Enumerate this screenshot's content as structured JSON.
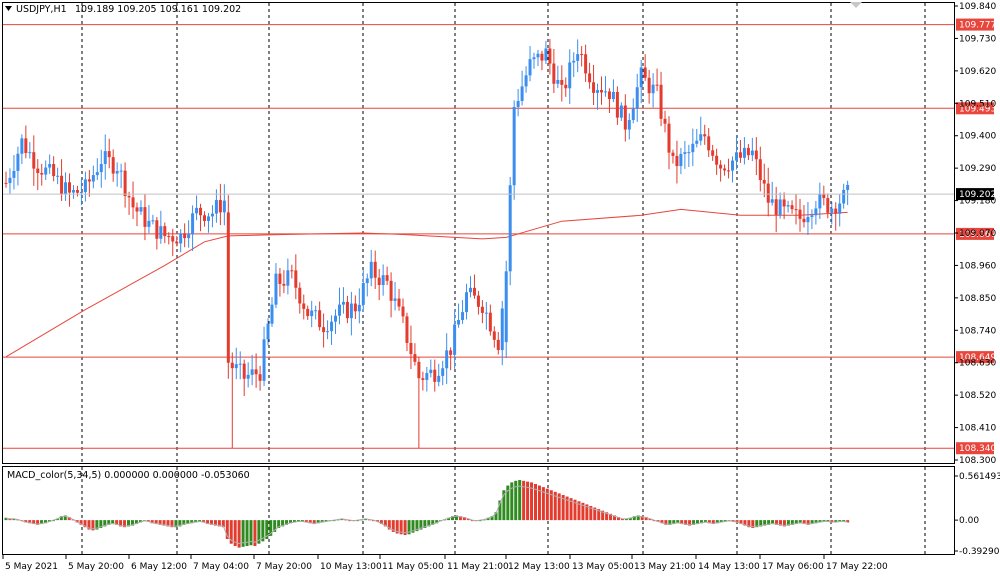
{
  "header": {
    "symbol_timeframe": "USDJPY,H1",
    "ohlc": "109.189 109.205 109.161 109.202"
  },
  "macd_header": "MACD_color(5,34,5) 0.000000 0.000000 -0.053060",
  "colors": {
    "bull": "#3b8ef0",
    "bear": "#e33b2e",
    "level": "#e8453c",
    "ma": "#e8453c",
    "grid": "#000000",
    "hist_up": "#2f8a1f",
    "hist_down": "#e33b2e",
    "signal": "#b0b0b0"
  },
  "icons": {
    "dropdown": "triangle-down-icon",
    "scroll": "chevron-down-icon"
  },
  "chart_data": [
    {
      "type": "candlestick",
      "title": "USDJPY,H1",
      "ylim": [
        108.3,
        109.84
      ],
      "price_ticks": [
        "109.840",
        "109.730",
        "109.620",
        "109.510",
        "109.400",
        "109.290",
        "109.180",
        "109.070",
        "108.960",
        "108.850",
        "108.740",
        "108.630",
        "108.520",
        "108.410",
        "108.300"
      ],
      "time_ticks": [
        "5 May 2021",
        "5 May 20:00",
        "6 May 12:00",
        "7 May 04:00",
        "7 May 20:00",
        "10 May 13:00",
        "11 May 05:00",
        "11 May 21:00",
        "12 May 13:00",
        "13 May 05:00",
        "13 May 21:00",
        "14 May 13:00",
        "17 May 06:00",
        "17 May 22:00"
      ],
      "levels": [
        {
          "label": "109.777",
          "value": 109.777
        },
        {
          "label": "109.493",
          "value": 109.493
        },
        {
          "label": "109.067",
          "value": 109.067
        },
        {
          "label": "108.649",
          "value": 108.649
        },
        {
          "label": "108.340",
          "value": 108.34
        }
      ],
      "current_price": {
        "label": "109.202",
        "value": 109.202
      },
      "anchors": [
        [
          0,
          109.24
        ],
        [
          4,
          109.38
        ],
        [
          8,
          109.3
        ],
        [
          12,
          109.26
        ],
        [
          16,
          109.2
        ],
        [
          20,
          109.22
        ],
        [
          24,
          109.32
        ],
        [
          28,
          109.3
        ],
        [
          32,
          109.16
        ],
        [
          36,
          109.1
        ],
        [
          40,
          109.06
        ],
        [
          44,
          109.06
        ],
        [
          48,
          109.14
        ],
        [
          52,
          109.14
        ],
        [
          55,
          109.18
        ],
        [
          56,
          108.63
        ],
        [
          60,
          108.58
        ],
        [
          64,
          108.6
        ],
        [
          68,
          108.9
        ],
        [
          72,
          108.92
        ],
        [
          76,
          108.8
        ],
        [
          80,
          108.76
        ],
        [
          84,
          108.8
        ],
        [
          88,
          108.82
        ],
        [
          92,
          108.94
        ],
        [
          96,
          108.9
        ],
        [
          100,
          108.76
        ],
        [
          104,
          108.58
        ],
        [
          108,
          108.6
        ],
        [
          112,
          108.68
        ],
        [
          116,
          108.86
        ],
        [
          120,
          108.83
        ],
        [
          124,
          108.7
        ],
        [
          126,
          108.94
        ],
        [
          128,
          109.5
        ],
        [
          132,
          109.64
        ],
        [
          136,
          109.68
        ],
        [
          140,
          109.54
        ],
        [
          144,
          109.7
        ],
        [
          148,
          109.58
        ],
        [
          152,
          109.55
        ],
        [
          156,
          109.44
        ],
        [
          160,
          109.6
        ],
        [
          164,
          109.54
        ],
        [
          168,
          109.3
        ],
        [
          172,
          109.34
        ],
        [
          176,
          109.4
        ],
        [
          180,
          109.3
        ],
        [
          184,
          109.32
        ],
        [
          188,
          109.34
        ],
        [
          192,
          109.18
        ],
        [
          196,
          109.14
        ],
        [
          200,
          109.12
        ],
        [
          204,
          109.18
        ],
        [
          208,
          109.16
        ],
        [
          212,
          109.2
        ]
      ],
      "ma_points": [
        [
          0,
          108.65
        ],
        [
          20,
          108.81
        ],
        [
          40,
          108.96
        ],
        [
          50,
          109.04
        ],
        [
          56,
          109.06
        ],
        [
          70,
          109.065
        ],
        [
          90,
          109.07
        ],
        [
          100,
          109.065
        ],
        [
          120,
          109.05
        ],
        [
          126,
          109.055
        ],
        [
          140,
          109.11
        ],
        [
          160,
          109.13
        ],
        [
          170,
          109.15
        ],
        [
          185,
          109.13
        ],
        [
          200,
          109.13
        ],
        [
          212,
          109.14
        ]
      ]
    },
    {
      "type": "bar",
      "title": "MACD_color(5,34,5)",
      "ylim": [
        -0.392902,
        0.561493
      ],
      "ticks": [
        "0.561493",
        "0.00",
        "-0.392902"
      ],
      "values": [
        0.03,
        0.02,
        0.02,
        0.01,
        -0.01,
        -0.03,
        -0.04,
        -0.05,
        -0.06,
        -0.05,
        -0.04,
        -0.02,
        0.0,
        0.02,
        0.05,
        0.06,
        0.04,
        0.01,
        -0.03,
        -0.06,
        -0.09,
        -0.12,
        -0.13,
        -0.12,
        -0.1,
        -0.08,
        -0.06,
        -0.05,
        -0.06,
        -0.08,
        -0.09,
        -0.08,
        -0.07,
        -0.05,
        -0.03,
        -0.01,
        -0.02,
        -0.04,
        -0.05,
        -0.06,
        -0.07,
        -0.08,
        -0.09,
        -0.09,
        -0.08,
        -0.06,
        -0.05,
        -0.04,
        -0.03,
        -0.02,
        -0.03,
        -0.05,
        -0.06,
        -0.07,
        -0.08,
        -0.09,
        -0.24,
        -0.3,
        -0.33,
        -0.35,
        -0.34,
        -0.33,
        -0.32,
        -0.33,
        -0.3,
        -0.27,
        -0.24,
        -0.2,
        -0.15,
        -0.1,
        -0.08,
        -0.06,
        -0.04,
        -0.03,
        -0.02,
        -0.02,
        -0.03,
        -0.04,
        -0.05,
        -0.04,
        -0.03,
        -0.02,
        -0.01,
        0.0,
        0.01,
        0.02,
        0.01,
        0.0,
        -0.01,
        0.0,
        0.01,
        0.02,
        0.01,
        0.0,
        -0.02,
        -0.05,
        -0.08,
        -0.12,
        -0.15,
        -0.17,
        -0.18,
        -0.19,
        -0.18,
        -0.16,
        -0.14,
        -0.12,
        -0.1,
        -0.08,
        -0.06,
        -0.04,
        -0.01,
        0.01,
        0.03,
        0.05,
        0.06,
        0.05,
        0.04,
        0.02,
        0.0,
        -0.01,
        0.0,
        0.01,
        0.03,
        0.05,
        0.1,
        0.25,
        0.38,
        0.44,
        0.48,
        0.5,
        0.51,
        0.5,
        0.49,
        0.48,
        0.46,
        0.44,
        0.42,
        0.4,
        0.38,
        0.36,
        0.34,
        0.32,
        0.3,
        0.28,
        0.26,
        0.24,
        0.22,
        0.2,
        0.18,
        0.16,
        0.14,
        0.12,
        0.1,
        0.08,
        0.06,
        0.04,
        0.02,
        0.02,
        0.03,
        0.05,
        0.06,
        0.05,
        0.04,
        0.02,
        0.0,
        -0.02,
        -0.04,
        -0.06,
        -0.06,
        -0.05,
        -0.04,
        -0.05,
        -0.06,
        -0.07,
        -0.06,
        -0.05,
        -0.04,
        -0.03,
        -0.04,
        -0.05,
        -0.04,
        -0.03,
        -0.02,
        -0.01,
        -0.02,
        -0.03,
        -0.05,
        -0.07,
        -0.09,
        -0.1,
        -0.09,
        -0.08,
        -0.07,
        -0.06,
        -0.05,
        -0.06,
        -0.07,
        -0.08,
        -0.07,
        -0.06,
        -0.05,
        -0.04,
        -0.05,
        -0.06,
        -0.05,
        -0.04,
        -0.03,
        -0.02,
        -0.02,
        -0.03,
        -0.03,
        -0.02,
        -0.02,
        -0.03
      ]
    }
  ]
}
